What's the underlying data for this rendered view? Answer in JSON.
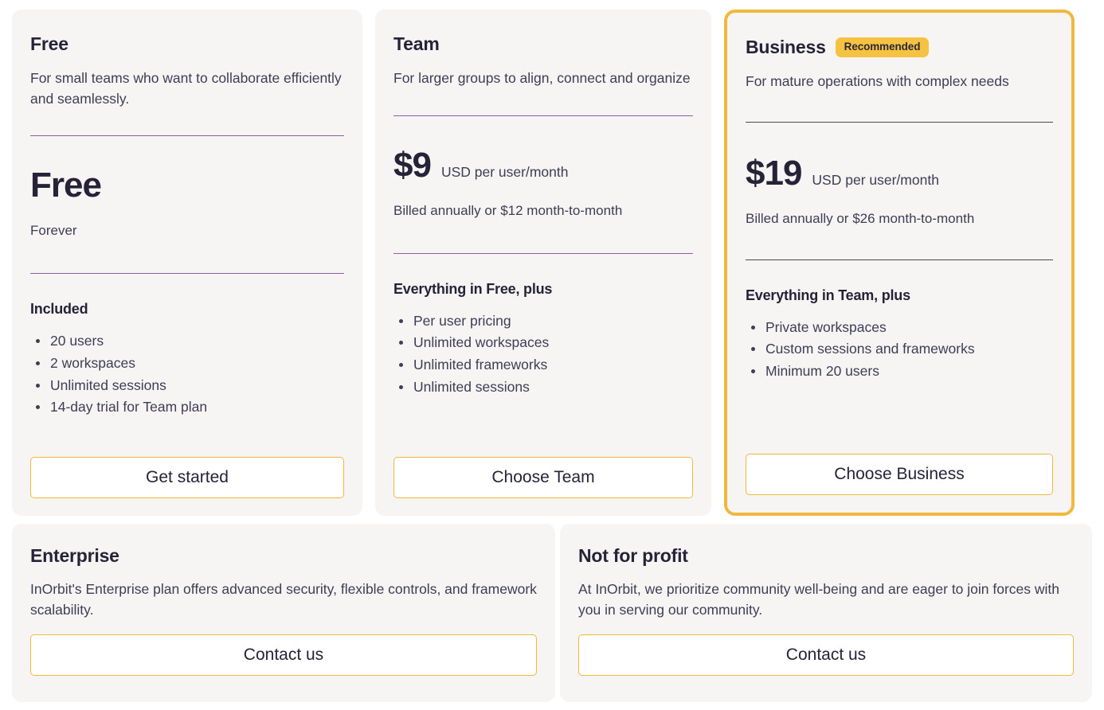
{
  "plans": [
    {
      "name": "Free",
      "badge": null,
      "description": "For small teams who want to collaborate efficiently and seamlessly.",
      "price_amount": "Free",
      "price_unit": "",
      "price_sub": "Forever",
      "features_title": "Included",
      "features": [
        "20 users",
        "2 workspaces",
        "Unlimited sessions",
        "14-day trial for Team plan"
      ],
      "cta_label": "Get started",
      "divider_color": "#8d5fa8"
    },
    {
      "name": "Team",
      "badge": null,
      "description": "For larger groups to align, connect and organize",
      "price_amount": "$9",
      "price_unit": "USD per user/month",
      "price_sub": "Billed annually or $12 month-to-month",
      "features_title": "Everything in Free, plus",
      "features": [
        "Per user pricing",
        "Unlimited workspaces",
        "Unlimited frameworks",
        "Unlimited sessions"
      ],
      "cta_label": "Choose Team",
      "divider_color": "#8d5fa8"
    },
    {
      "name": "Business",
      "badge": "Recommended",
      "description": "For mature operations with complex needs",
      "price_amount": "$19",
      "price_unit": "USD per user/month",
      "price_sub": "Billed annually or $26 month-to-month",
      "features_title": "Everything in Team, plus",
      "features": [
        "Private workspaces",
        "Custom sessions and frameworks",
        "Minimum 20 users"
      ],
      "cta_label": "Choose Business",
      "divider_color": "#4a4a4a"
    }
  ],
  "extras": [
    {
      "title": "Enterprise",
      "description": "InOrbit's Enterprise plan offers advanced security, flexible controls, and framework scalability.",
      "cta_label": "Contact us"
    },
    {
      "title": "Not for profit",
      "description": "At InOrbit, we prioritize community well-being and are eager to join forces with you in serving our community.",
      "cta_label": "Contact us"
    }
  ],
  "colors": {
    "accent": "#f0b93e",
    "badge_bg": "#f5c242",
    "card_bg": "#f6f5f3",
    "page_bg": "#ffffff",
    "text_primary": "#262339",
    "text_body": "#3f3d56",
    "divider_purple": "#8d5fa8",
    "divider_dark": "#4a4a4a"
  }
}
